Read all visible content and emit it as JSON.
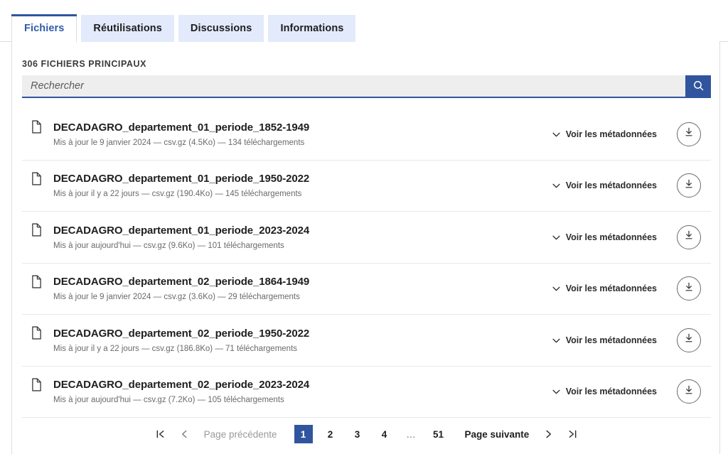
{
  "tabs": [
    {
      "label": "Fichiers",
      "active": true
    },
    {
      "label": "Réutilisations",
      "active": false
    },
    {
      "label": "Discussions",
      "active": false
    },
    {
      "label": "Informations",
      "active": false
    }
  ],
  "section": {
    "title": "306 FICHIERS PRINCIPAUX"
  },
  "search": {
    "value": "",
    "placeholder": "Rechercher",
    "button_icon": "search-icon"
  },
  "files": [
    {
      "icon": "file-icon",
      "title": "DECADAGRO_departement_01_periode_1852-1949",
      "meta": "Mis à jour le 9 janvier 2024 — csv.gz (4.5Ko) — 134 téléchargements",
      "metadata_label": "Voir les métadonnées",
      "download_icon": "download-icon"
    },
    {
      "icon": "file-icon",
      "title": "DECADAGRO_departement_01_periode_1950-2022",
      "meta": "Mis à jour il y a 22 jours — csv.gz (190.4Ko) — 145 téléchargements",
      "metadata_label": "Voir les métadonnées",
      "download_icon": "download-icon"
    },
    {
      "icon": "file-icon",
      "title": "DECADAGRO_departement_01_periode_2023-2024",
      "meta": "Mis à jour aujourd'hui — csv.gz (9.6Ko) — 101 téléchargements",
      "metadata_label": "Voir les métadonnées",
      "download_icon": "download-icon"
    },
    {
      "icon": "file-icon",
      "title": "DECADAGRO_departement_02_periode_1864-1949",
      "meta": "Mis à jour le 9 janvier 2024 — csv.gz (3.6Ko) — 29 téléchargements",
      "metadata_label": "Voir les métadonnées",
      "download_icon": "download-icon"
    },
    {
      "icon": "file-icon",
      "title": "DECADAGRO_departement_02_periode_1950-2022",
      "meta": "Mis à jour il y a 22 jours — csv.gz (186.8Ko) — 71 téléchargements",
      "metadata_label": "Voir les métadonnées",
      "download_icon": "download-icon"
    },
    {
      "icon": "file-icon",
      "title": "DECADAGRO_departement_02_periode_2023-2024",
      "meta": "Mis à jour aujourd'hui — csv.gz (7.2Ko) — 105 téléchargements",
      "metadata_label": "Voir les métadonnées",
      "download_icon": "download-icon"
    }
  ],
  "pagination": {
    "first_icon": "first-page-icon",
    "prev_icon": "chevron-left-icon",
    "prev_label": "Page précédente",
    "pages": [
      "1",
      "2",
      "3",
      "4",
      "…",
      "51"
    ],
    "current_page": "1",
    "next_label": "Page suivante",
    "next_icon": "chevron-right-icon",
    "last_icon": "last-page-icon"
  },
  "colors": {
    "accent": "#30559e",
    "tab_inactive_bg": "#e3eafc",
    "search_bg": "#eeeeee",
    "border": "#dddddd",
    "muted_text": "#6a6a6a"
  }
}
